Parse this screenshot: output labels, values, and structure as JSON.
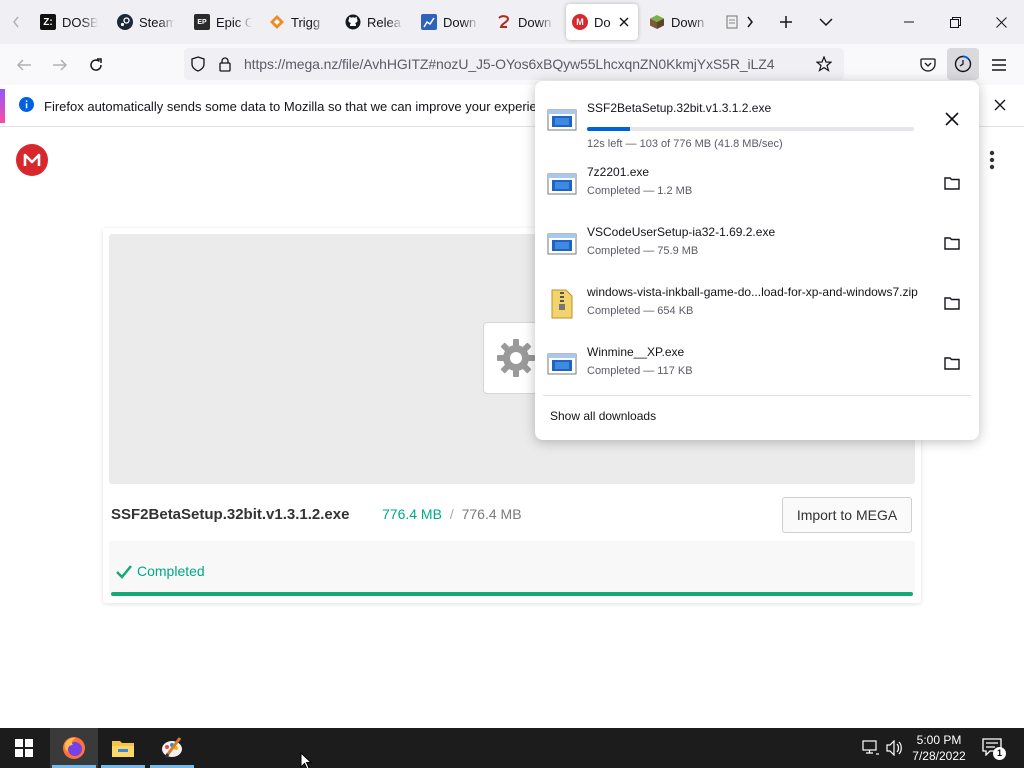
{
  "browser": {
    "tabs": [
      {
        "label": "DOSB",
        "icon": "dosbox-icon"
      },
      {
        "label": "Steam",
        "icon": "steam-icon"
      },
      {
        "label": "Epic G",
        "icon": "epic-games-icon"
      },
      {
        "label": "Trigg",
        "icon": "trigger-icon"
      },
      {
        "label": "Relea",
        "icon": "github-icon"
      },
      {
        "label": "Down",
        "icon": "download-site-icon"
      },
      {
        "label": "Down",
        "icon": "download-site-icon"
      },
      {
        "label": "Do",
        "icon": "mega-icon",
        "active": true
      },
      {
        "label": "Down",
        "icon": "minecraft-icon"
      }
    ],
    "url": "https://mega.nz/file/AvhHGITZ#nozU_J5-OYos6xBQyw55LhcxqnZN0KkmjYxS5R_iLZ4",
    "info_bar": "Firefox automatically sends some data to Mozilla so that we can improve your experience."
  },
  "mega": {
    "file_name": "SSF2BetaSetup.32bit.v1.3.1.2.exe",
    "downloaded": "776.4 MB",
    "separator": "/",
    "total": "776.4 MB",
    "import_label": "Import to MEGA",
    "status": "Completed",
    "progress": 1.0
  },
  "downloads_panel": {
    "items": [
      {
        "name": "SSF2BetaSetup.32bit.v1.3.1.2.exe",
        "status": "12s left — 103 of 776 MB (41.8 MB/sec)",
        "progress": 0.13,
        "icon": "exe-file-icon",
        "action": "cancel"
      },
      {
        "name": "7z2201.exe",
        "status": "Completed — 1.2 MB",
        "icon": "exe-file-icon",
        "action": "show-in-folder"
      },
      {
        "name": "VSCodeUserSetup-ia32-1.69.2.exe",
        "status": "Completed — 75.9 MB",
        "icon": "exe-file-icon",
        "action": "show-in-folder"
      },
      {
        "name": "windows-vista-inkball-game-do...load-for-xp-and-windows7.zip",
        "status": "Completed — 654 KB",
        "icon": "zip-file-icon",
        "action": "show-in-folder"
      },
      {
        "name": "Winmine__XP.exe",
        "status": "Completed — 117 KB",
        "icon": "exe-file-icon",
        "action": "show-in-folder"
      }
    ],
    "show_all": "Show all downloads"
  },
  "taskbar": {
    "time": "5:00 PM",
    "date": "7/28/2022",
    "notification_count": "1",
    "apps": [
      "firefox-icon",
      "file-explorer-icon",
      "paint-icon"
    ]
  }
}
